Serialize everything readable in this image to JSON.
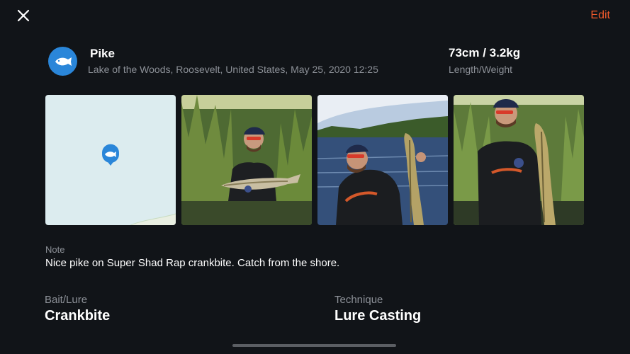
{
  "header": {
    "edit_label": "Edit"
  },
  "catch": {
    "species": "Pike",
    "meta": "Lake of the Woods, Roosevelt, United States, May 25, 2020 12:25",
    "measurement": "73cm / 3.2kg",
    "measurement_label": "Length/Weight"
  },
  "media": [
    {
      "kind": "map"
    },
    {
      "kind": "photo",
      "subject": "angler holding pike horizontally in reeds"
    },
    {
      "kind": "photo",
      "subject": "angler holding pike vertically by the lake"
    },
    {
      "kind": "photo",
      "subject": "angler holding pike vertically in grass"
    }
  ],
  "note": {
    "label": "Note",
    "text": "Nice pike on Super Shad Rap crankbite. Catch from the shore."
  },
  "details": {
    "bait_label": "Bait/Lure",
    "bait_value": "Crankbite",
    "technique_label": "Technique",
    "technique_value": "Lure Casting"
  },
  "colors": {
    "accent": "#f15a2b",
    "brand_blue": "#2a86d9",
    "background": "#111418",
    "muted": "#8c9097"
  },
  "icons": {
    "close": "close-icon",
    "species": "fish-icon",
    "map_marker": "fish-map-marker-icon"
  }
}
